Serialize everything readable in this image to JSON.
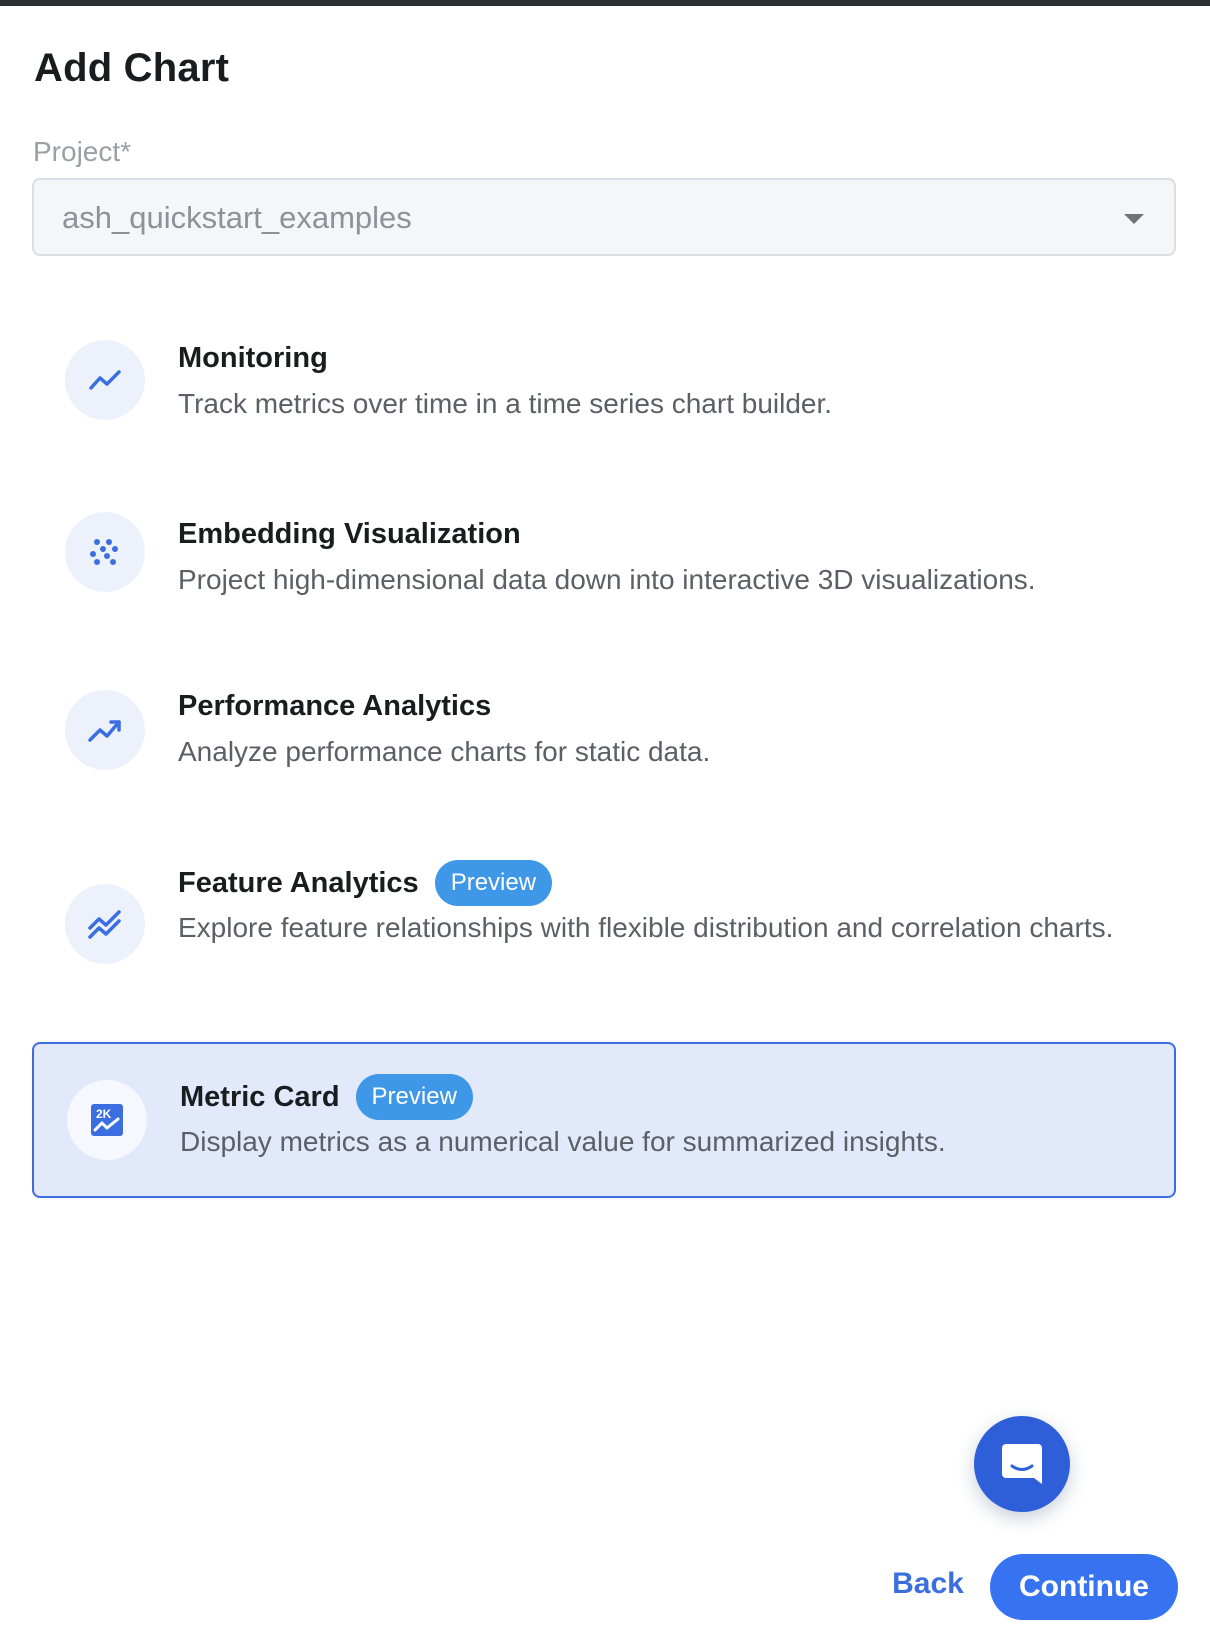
{
  "dialog": {
    "title": "Add Chart"
  },
  "project_field": {
    "label": "Project*",
    "value": "ash_quickstart_examples"
  },
  "options": [
    {
      "title": "Monitoring",
      "description": "Track metrics over time in a time series chart builder.",
      "icon": "line-chart-icon",
      "selected": false
    },
    {
      "title": "Embedding Visualization",
      "description": "Project high-dimensional data down into interactive 3D visualizations.",
      "icon": "scatter-dots-icon",
      "selected": false
    },
    {
      "title": "Performance Analytics",
      "description": "Analyze performance charts for static data.",
      "icon": "trending-up-icon",
      "selected": false
    },
    {
      "title": "Feature Analytics",
      "badge": "Preview",
      "description": "Explore feature relationships with flexible distribution and correlation charts.",
      "icon": "double-line-chart-icon",
      "selected": false
    },
    {
      "title": "Metric Card",
      "badge": "Preview",
      "description": "Display metrics as a numerical value for summarized insights.",
      "icon": "metric-card-icon",
      "selected": true
    }
  ],
  "footer": {
    "back_label": "Back",
    "continue_label": "Continue"
  },
  "colors": {
    "accent": "#3773f0",
    "selected_bg": "#e1e9fb",
    "badge": "#3f97e8",
    "chat_button": "#2f5fd8"
  }
}
